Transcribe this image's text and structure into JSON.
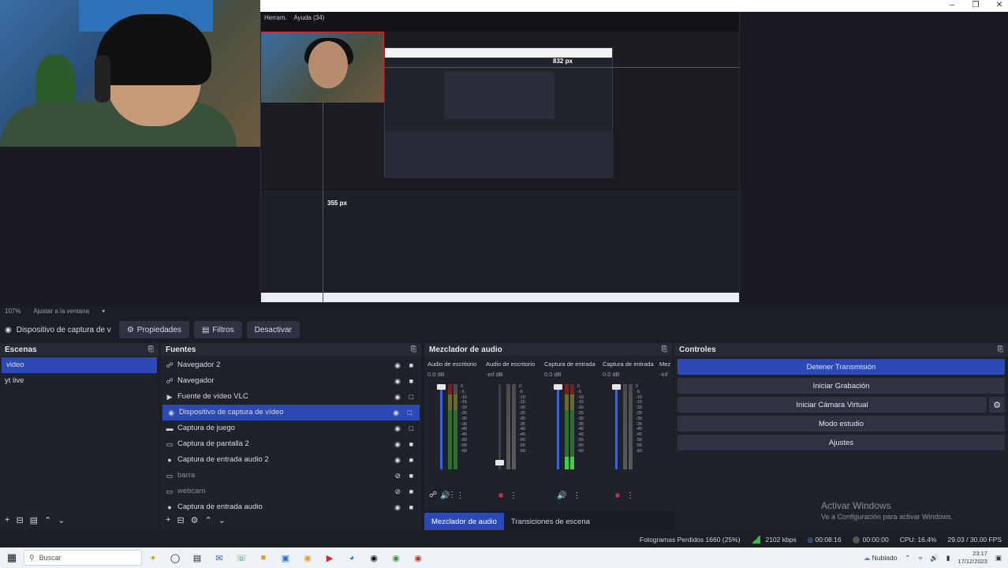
{
  "nested_menu": {
    "items": [
      "Herram.",
      "Ayuda (34)"
    ]
  },
  "preview": {
    "px_label_top": "832 px",
    "px_label_left": "355 px"
  },
  "zoombar": {
    "zoom": "107%",
    "fit": "Ajustar a la ventana"
  },
  "source_toolbar": {
    "source_name": "Dispositivo de captura de v",
    "properties_label": "Propiedades",
    "filters_label": "Filtros",
    "deactivate_label": "Desactivar"
  },
  "scenes": {
    "title": "Escenas",
    "items": [
      {
        "label": "video"
      },
      {
        "label": "yt live"
      }
    ]
  },
  "sources": {
    "title": "Fuentes",
    "items": [
      {
        "label": "Navegador 2",
        "icon": "globe"
      },
      {
        "label": "Navegador",
        "icon": "globe"
      },
      {
        "label": "Fuente de vídeo VLC",
        "icon": "play"
      },
      {
        "label": "Dispositivo de captura de vídeo",
        "icon": "camera"
      },
      {
        "label": "Captura de juego",
        "icon": "gamepad"
      },
      {
        "label": "Captura de pantalla 2",
        "icon": "monitor"
      },
      {
        "label": "Captura de entrada audio 2",
        "icon": "mic"
      },
      {
        "label": "barra",
        "icon": "monitor"
      },
      {
        "label": "webcam",
        "icon": "monitor"
      },
      {
        "label": "Captura de entrada audio",
        "icon": "mic"
      }
    ]
  },
  "mixer": {
    "title": "Mezclador de audio",
    "channels": [
      {
        "name": "Audio de escritorio",
        "db": "0.0 dB"
      },
      {
        "name": "Audio de escritorio",
        "db": "-inf dB"
      },
      {
        "name": "Captura de entrada",
        "db": "0.0 dB"
      },
      {
        "name": "Captura de entrada",
        "db": "0.0 dB"
      }
    ],
    "extra_name": "Mez",
    "extra_db": "-inf",
    "ticks": [
      "0",
      "-5",
      "-10",
      "-15",
      "-20",
      "-25",
      "-30",
      "-35",
      "-40",
      "-45",
      "-50",
      "-55",
      "-60"
    ],
    "tabs": [
      "Mezclador de audio",
      "Transiciones de escena"
    ]
  },
  "controls": {
    "title": "Controles",
    "stop_stream": "Detener Transmisión",
    "start_rec": "Iniciar Grabación",
    "start_vcam": "Iniciar Cámara Virtual",
    "studio_mode": "Modo estudio",
    "settings": "Ajustes",
    "activate_title": "Activar Windows",
    "activate_sub": "Ve a Configuración para activar Windows."
  },
  "status": {
    "dropped": "Fotogramas Perdidos 1660 (25%)",
    "kbps": "2102 kbps",
    "live_time": "00:08:16",
    "rec_time": "00:00:00",
    "cpu": "CPU: 16.4%",
    "fps": "29.03 / 30.00 FPS"
  },
  "taskbar": {
    "search_placeholder": "Buscar",
    "weather": "Nublado",
    "time": "23:17",
    "date": "17/12/2023"
  },
  "colors": {
    "accent": "#2c49b5",
    "panel": "#1f212b",
    "header": "#272a35"
  }
}
